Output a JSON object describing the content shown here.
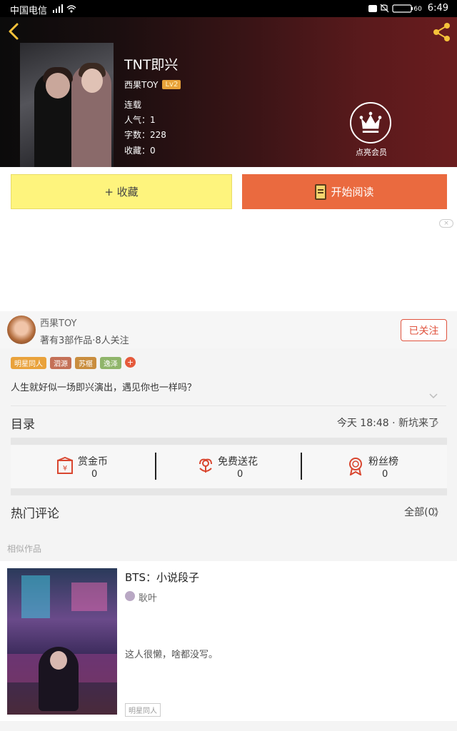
{
  "status_bar": {
    "carrier": "中国电信",
    "battery": "60",
    "time": "6:49"
  },
  "book": {
    "title": "TNT即兴",
    "author": "西果TOY",
    "level": "Lv2",
    "status": "连载",
    "popularity": "人气：1",
    "word_count": "字数：228",
    "favorites": "收藏：0"
  },
  "vip": {
    "label": "点亮会员"
  },
  "actions": {
    "favorite_label": "+ 收藏",
    "read_label": "开始阅读"
  },
  "ad": {
    "close_label": "×"
  },
  "author_section": {
    "name": "西果TOY",
    "meta": "著有3部作品·8人关注",
    "follow_label": "已关注"
  },
  "tags": [
    {
      "label": "明星同人",
      "color": "#e9a23b"
    },
    {
      "label": "泗源",
      "color": "#c47056"
    },
    {
      "label": "苏椹",
      "color": "#c98d3e"
    },
    {
      "label": "逸泽",
      "color": "#8fb56a"
    }
  ],
  "tag_add_label": "+",
  "intro": "人生就好似一场即兴演出，遇见你也一样吗？",
  "toc": {
    "label": "目录",
    "update": "今天 18:48 · 新坑来了"
  },
  "stats": [
    {
      "label": "赏金币",
      "value": "0",
      "icon": "reward-coin-icon"
    },
    {
      "label": "免费送花",
      "value": "0",
      "icon": "flower-icon"
    },
    {
      "label": "粉丝榜",
      "value": "0",
      "icon": "medal-icon"
    }
  ],
  "comments": {
    "label": "热门评论",
    "all": "全部(0)"
  },
  "similar": {
    "label": "相似作品",
    "items": [
      {
        "title": "BTS：小说段子",
        "author": "耿叶",
        "desc": "这人很懒，啥都没写。",
        "tag": "明星同人"
      }
    ]
  },
  "colors": {
    "accent_orange": "#ea6a3f",
    "fav_yellow": "#fef47d",
    "follow_red": "#e0533e"
  }
}
